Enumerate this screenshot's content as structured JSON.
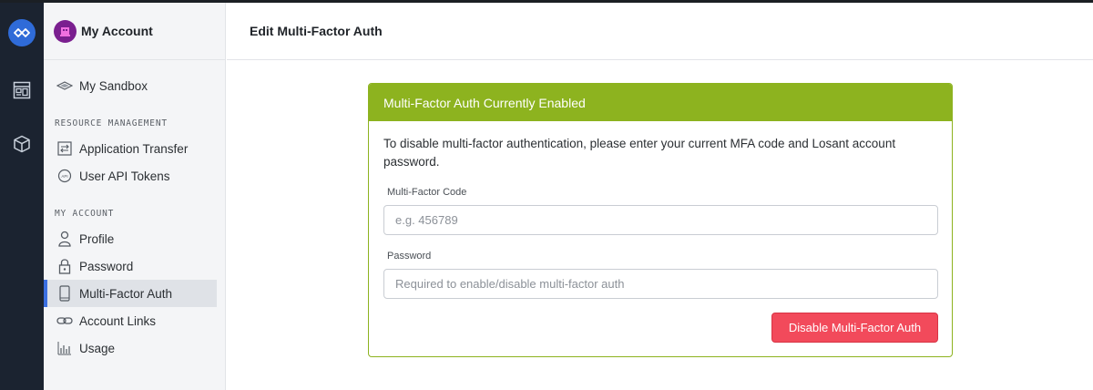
{
  "app": {
    "brand_color": "#2f6bd8",
    "rail_color": "#1b2330"
  },
  "rail": {
    "icons": [
      "losant-logo-icon",
      "dashboard-icon",
      "cube-icon"
    ]
  },
  "sidebar": {
    "title": "My Account",
    "sandbox_label": "My Sandbox",
    "section_resource": "RESOURCE MANAGEMENT",
    "resource_items": [
      {
        "label": "Application Transfer",
        "icon": "transfer-icon"
      },
      {
        "label": "User API Tokens",
        "icon": "api-token-icon"
      }
    ],
    "section_account": "MY ACCOUNT",
    "account_items": [
      {
        "label": "Profile",
        "icon": "person-icon"
      },
      {
        "label": "Password",
        "icon": "lock-icon"
      },
      {
        "label": "Multi-Factor Auth",
        "icon": "phone-icon",
        "active": true
      },
      {
        "label": "Account Links",
        "icon": "link-icon"
      },
      {
        "label": "Usage",
        "icon": "bar-chart-icon"
      }
    ],
    "active_color": "#3b6fe0"
  },
  "header": {
    "title": "Edit Multi-Factor Auth"
  },
  "card": {
    "title": "Multi-Factor Auth Currently Enabled",
    "accent_color": "#8db31f",
    "description": "To disable multi-factor authentication, please enter your current MFA code and Losant account password.",
    "code_label": "Multi-Factor Code",
    "code_placeholder": "e.g. 456789",
    "code_value": "",
    "password_label": "Password",
    "password_placeholder": "Required to enable/disable multi-factor auth",
    "password_value": "",
    "button_label": "Disable Multi-Factor Auth",
    "button_color": "#f24a5b"
  }
}
